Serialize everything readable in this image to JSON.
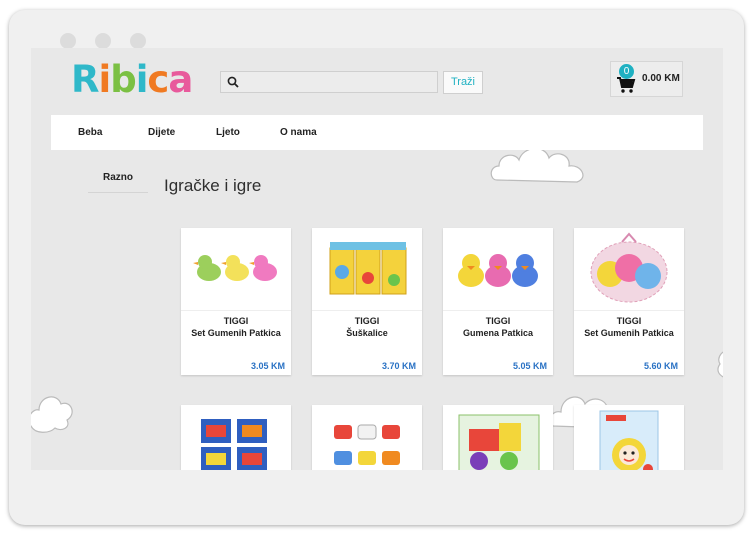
{
  "header": {
    "logo_letters": [
      "R",
      "i",
      "b",
      "i",
      "c",
      "a"
    ],
    "logo_colors": [
      "#2fb8c9",
      "#f07a22",
      "#7bc043",
      "#2fb8c9",
      "#f07a22",
      "#e85a9c"
    ],
    "search": {
      "value": "",
      "placeholder": ""
    },
    "search_button": "Traži",
    "cart": {
      "count": "0",
      "total": "0.00 KM"
    }
  },
  "nav": {
    "items": [
      "Beba",
      "Dijete",
      "Ljeto",
      "O nama"
    ]
  },
  "sidebar": {
    "items": [
      "Razno"
    ]
  },
  "main": {
    "title": "Igračke i igre",
    "products": [
      {
        "brand": "TIGGI",
        "name": "Set Gumenih Patkica",
        "price": "3.05 KM"
      },
      {
        "brand": "TIGGI",
        "name": "Šuškalice",
        "price": "3.70 KM"
      },
      {
        "brand": "TIGGI",
        "name": "Gumena Patkica",
        "price": "5.05 KM"
      },
      {
        "brand": "TIGGI",
        "name": "Set Gumenih Patkica",
        "price": "5.60 KM"
      },
      {
        "brand": "",
        "name": "",
        "price": ""
      },
      {
        "brand": "",
        "name": "",
        "price": ""
      },
      {
        "brand": "",
        "name": "",
        "price": ""
      },
      {
        "brand": "",
        "name": "",
        "price": ""
      }
    ]
  },
  "colors": {
    "accent": "#1fb1c2",
    "price": "#2a72c4",
    "page_bg": "#e8e8e8"
  }
}
